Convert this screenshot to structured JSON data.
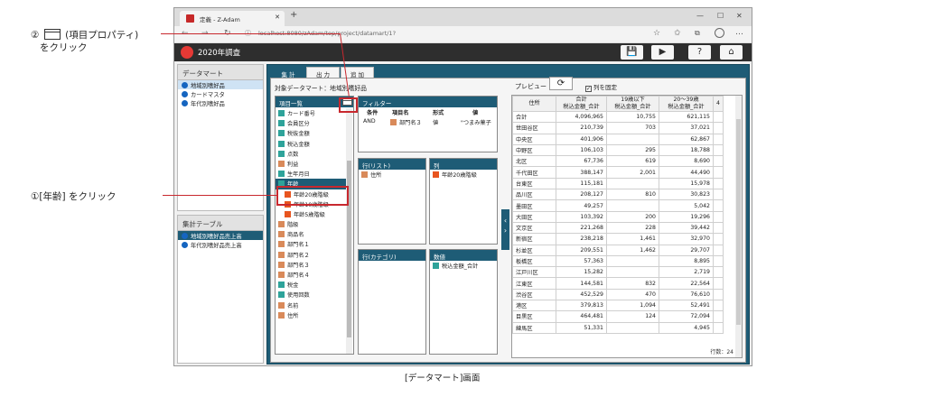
{
  "annotations": {
    "top_line1": "②",
    "top_line1_b": "(項目プロパティ)",
    "top_line2": "をクリック",
    "middle": "①[年齢] をクリック",
    "caption": "[データマート]画面",
    "accent": "#c8282e"
  },
  "browser": {
    "tab_title": "定義 - Z-Adam",
    "new_tab": "+",
    "url": "localhost:8080/zAdam/top/project/datamart/1?",
    "controls": [
      "—",
      "☐",
      "✕"
    ]
  },
  "app": {
    "title": "2020年調査",
    "buttons": [
      "save-icon",
      "play-icon",
      "help-icon",
      "home-icon"
    ]
  },
  "datamart_panel": {
    "header": "データマート",
    "items": [
      "地域別嗜好品",
      "カードマスタ",
      "年代別嗜好品"
    ]
  },
  "agg_panel": {
    "header": "集計テーブル",
    "items": [
      "地域別嗜好品売上高",
      "年代別嗜好品売上高"
    ]
  },
  "main_tabs": [
    "集 計",
    "出 力",
    "追 加"
  ],
  "target": "対象データマート：地域別嗜好品",
  "fields": {
    "header": "項目一覧",
    "items": [
      {
        "label": "カード番号",
        "type": "N"
      },
      {
        "label": "会員区分",
        "type": "N"
      },
      {
        "label": "税抜金額",
        "type": "N"
      },
      {
        "label": "税込金額",
        "type": "N"
      },
      {
        "label": "点数",
        "type": "N"
      },
      {
        "label": "利益",
        "type": "S"
      },
      {
        "label": "生年月日",
        "type": "N"
      },
      {
        "label": "年齢",
        "type": "N"
      },
      {
        "label": "年齢20歳階級",
        "type": "C"
      },
      {
        "label": "年齢10歳階級",
        "type": "C"
      },
      {
        "label": "年齢5歳階級",
        "type": "C"
      },
      {
        "label": "階級",
        "type": "S"
      },
      {
        "label": "商品名",
        "type": "S"
      },
      {
        "label": "部門名１",
        "type": "S"
      },
      {
        "label": "部門名２",
        "type": "S"
      },
      {
        "label": "部門名３",
        "type": "S"
      },
      {
        "label": "部門名４",
        "type": "S"
      },
      {
        "label": "税金",
        "type": "N"
      },
      {
        "label": "使用回数",
        "type": "N"
      },
      {
        "label": "名前",
        "type": "S"
      },
      {
        "label": "住所",
        "type": "S"
      }
    ]
  },
  "filter": {
    "header": "フィルター",
    "columns": [
      "条件",
      "項目名",
      "形式",
      "値"
    ],
    "row": [
      "AND",
      "部門名３",
      "値",
      "\"つまみ菓子"
    ]
  },
  "rows_box": {
    "header": "行(リスト)",
    "items": [
      "住所"
    ]
  },
  "cols_box": {
    "header": "列",
    "items": [
      "年齢20歳階級"
    ]
  },
  "cat_box": {
    "header": "行(カテゴリ)",
    "items": []
  },
  "val_box": {
    "header": "数値",
    "items": [
      "税込金額_合計"
    ]
  },
  "preview": {
    "label": "プレビュー",
    "checkbox": "列を固定",
    "headers": [
      "住所",
      "合計\n税込金額_合計",
      "19歳以下\n税込金額_合計",
      "20～39歳\n税込金額_合計",
      "4"
    ],
    "rows": [
      [
        "合計",
        "4,096,965",
        "10,755",
        "621,115"
      ],
      [
        "世田谷区",
        "210,739",
        "703",
        "37,021"
      ],
      [
        "中央区",
        "401,906",
        "",
        "62,867"
      ],
      [
        "中野区",
        "106,103",
        "295",
        "18,788"
      ],
      [
        "北区",
        "67,736",
        "619",
        "8,690"
      ],
      [
        "千代田区",
        "388,147",
        "2,001",
        "44,490"
      ],
      [
        "台東区",
        "115,181",
        "",
        "15,978"
      ],
      [
        "品川区",
        "208,127",
        "810",
        "30,823"
      ],
      [
        "墨田区",
        "49,257",
        "",
        "5,042"
      ],
      [
        "大田区",
        "103,392",
        "200",
        "19,296"
      ],
      [
        "文京区",
        "221,268",
        "228",
        "39,442"
      ],
      [
        "新宿区",
        "238,218",
        "1,461",
        "32,970"
      ],
      [
        "杉並区",
        "209,551",
        "1,462",
        "29,707"
      ],
      [
        "板橋区",
        "57,363",
        "",
        "8,895"
      ],
      [
        "江戸川区",
        "15,282",
        "",
        "2,719"
      ],
      [
        "江東区",
        "144,581",
        "832",
        "22,564"
      ],
      [
        "渋谷区",
        "452,529",
        "470",
        "76,610"
      ],
      [
        "港区",
        "379,813",
        "1,094",
        "52,491"
      ],
      [
        "目黒区",
        "464,481",
        "124",
        "72,094"
      ],
      [
        "練馬区",
        "51,331",
        "",
        "4,945"
      ]
    ],
    "footer": "行数：24"
  }
}
